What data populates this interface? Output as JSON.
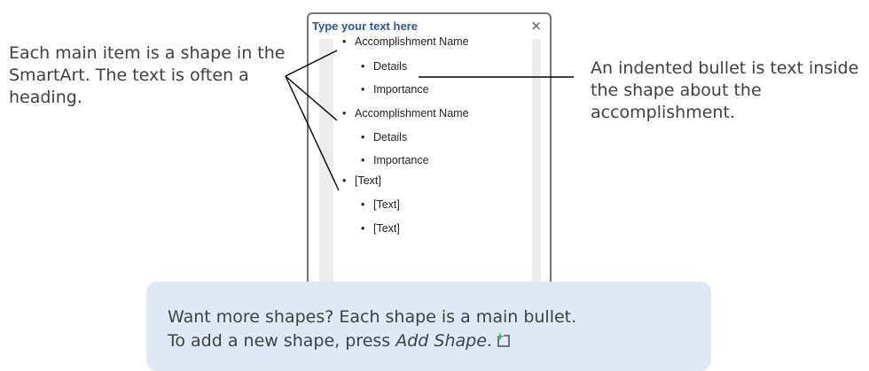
{
  "callout_left": "Each main item is a shape in the SmartArt. The text is often a heading.",
  "callout_right": "An indented bullet is text inside the shape about the accomplishment.",
  "pane": {
    "title": "Type your text here",
    "close_glyph": "×",
    "bullets": [
      {
        "text": "Accomplishment Name",
        "level": 1
      },
      {
        "text": "Details",
        "level": 2
      },
      {
        "text": "Importance",
        "level": 2
      },
      {
        "text": "Accomplishment Name",
        "level": 1
      },
      {
        "text": "Details",
        "level": 2
      },
      {
        "text": "Importance",
        "level": 2
      },
      {
        "text": "[Text]",
        "level": 1
      },
      {
        "text": "[Text]",
        "level": 2
      },
      {
        "text": "[Text]",
        "level": 2
      }
    ]
  },
  "tip": {
    "line1": "Want more shapes? Each shape is a main bullet.",
    "line2_prefix": "To add a new shape, press ",
    "line2_emphasis": "Add Shape",
    "line2_suffix": ".",
    "icon": "add-shape-icon",
    "icon_plus_color": "#2fb34a"
  },
  "colors": {
    "title_blue": "#2b579a",
    "tip_bg": "#dfe9f5",
    "pane_border": "#777777"
  }
}
